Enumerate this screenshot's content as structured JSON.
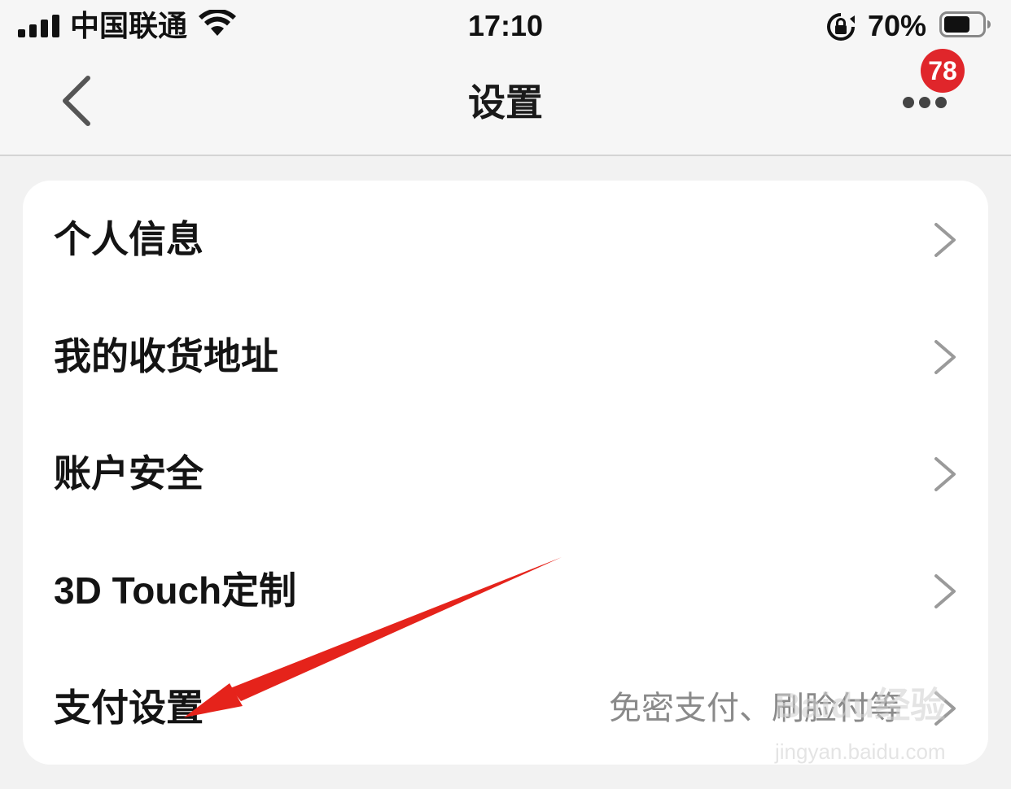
{
  "status_bar": {
    "carrier": "中国联通",
    "time": "17:10",
    "battery_percent": "70%",
    "signal_bars": 4,
    "battery_level": 0.7
  },
  "nav": {
    "title": "设置",
    "badge_count": "78",
    "back_icon": "chevron-left-icon",
    "more_icon": "more-dots-icon"
  },
  "settings": {
    "items": [
      {
        "label": "个人信息",
        "value": ""
      },
      {
        "label": "我的收货地址",
        "value": ""
      },
      {
        "label": "账户安全",
        "value": ""
      },
      {
        "label": "3D Touch定制",
        "value": ""
      },
      {
        "label": "支付设置",
        "value": "免密支付、刷脸付等"
      }
    ]
  },
  "watermark": {
    "logo": "Baidu经验",
    "url": "jingyan.baidu.com"
  },
  "colors": {
    "badge": "#e0262b",
    "annotation_arrow": "#e5231b",
    "background": "#f2f2f2",
    "card": "#ffffff"
  }
}
